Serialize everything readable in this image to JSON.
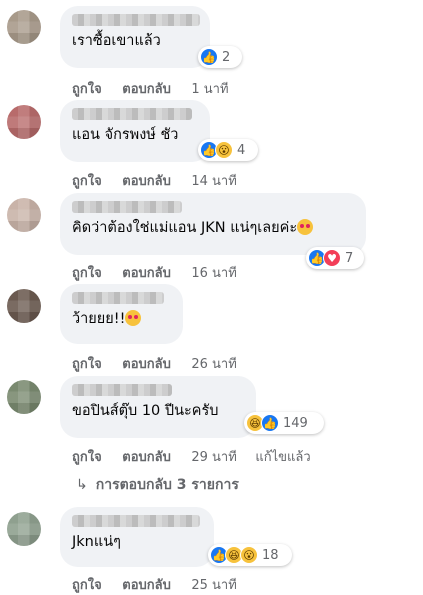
{
  "comments": [
    {
      "text": "เราซื้อเขาแล้ว",
      "reactions": {
        "icons": [
          "like-icon"
        ],
        "count": "2"
      },
      "actions": {
        "like": "ถูกใจ",
        "reply": "ตอบกลับ",
        "time": "1 นาที"
      },
      "colors": {
        "avatar": "#a89a8a"
      }
    },
    {
      "text": "แอน จักรพงษ์ ชัว",
      "reactions": {
        "icons": [
          "like-icon",
          "wow-icon"
        ],
        "count": "4"
      },
      "actions": {
        "like": "ถูกใจ",
        "reply": "ตอบกลับ",
        "time": "14 นาที"
      },
      "colors": {
        "avatar": "#b86b6b"
      }
    },
    {
      "text": "คิดว่าต้องใช่แม่แอน JKN แน่ๆเลยค่ะ",
      "reactions": {
        "icons": [
          "like-icon",
          "heart-icon"
        ],
        "count": "7"
      },
      "actions": {
        "like": "ถูกใจ",
        "reply": "ตอบกลับ",
        "time": "16 นาที"
      },
      "colors": {
        "avatar": "#c9b3a8"
      }
    },
    {
      "text_line2": "ว้ายยย!!",
      "actions": {
        "like": "ถูกใจ",
        "reply": "ตอบกลับ",
        "time": "26 นาที"
      },
      "colors": {
        "avatar": "#6b5a50"
      }
    },
    {
      "text": "ขอปินส์ตุ๊บ 10 ปีนะครับ",
      "reactions": {
        "icons": [
          "haha-icon",
          "like-icon"
        ],
        "count": "149"
      },
      "actions": {
        "like": "ถูกใจ",
        "reply": "ตอบกลับ",
        "time": "29 นาที",
        "edited": "แก้ไขแล้ว"
      },
      "colors": {
        "avatar": "#7a8a70"
      }
    },
    {
      "text": "Jknแน่ๆ",
      "reactions": {
        "icons": [
          "like-icon",
          "haha-icon",
          "wow-icon"
        ],
        "count": "18"
      },
      "actions": {
        "like": "ถูกใจ",
        "reply": "ตอบกลับ",
        "time": "25 นาที"
      },
      "colors": {
        "avatar": "#8fa08f"
      }
    }
  ],
  "replies": {
    "arrow": "↳",
    "label": "การตอบกลับ 3 รายการ"
  },
  "colors": {
    "bubble": "#f0f2f5",
    "like_blue": "#1877f2",
    "secondary_text": "#65676b"
  }
}
